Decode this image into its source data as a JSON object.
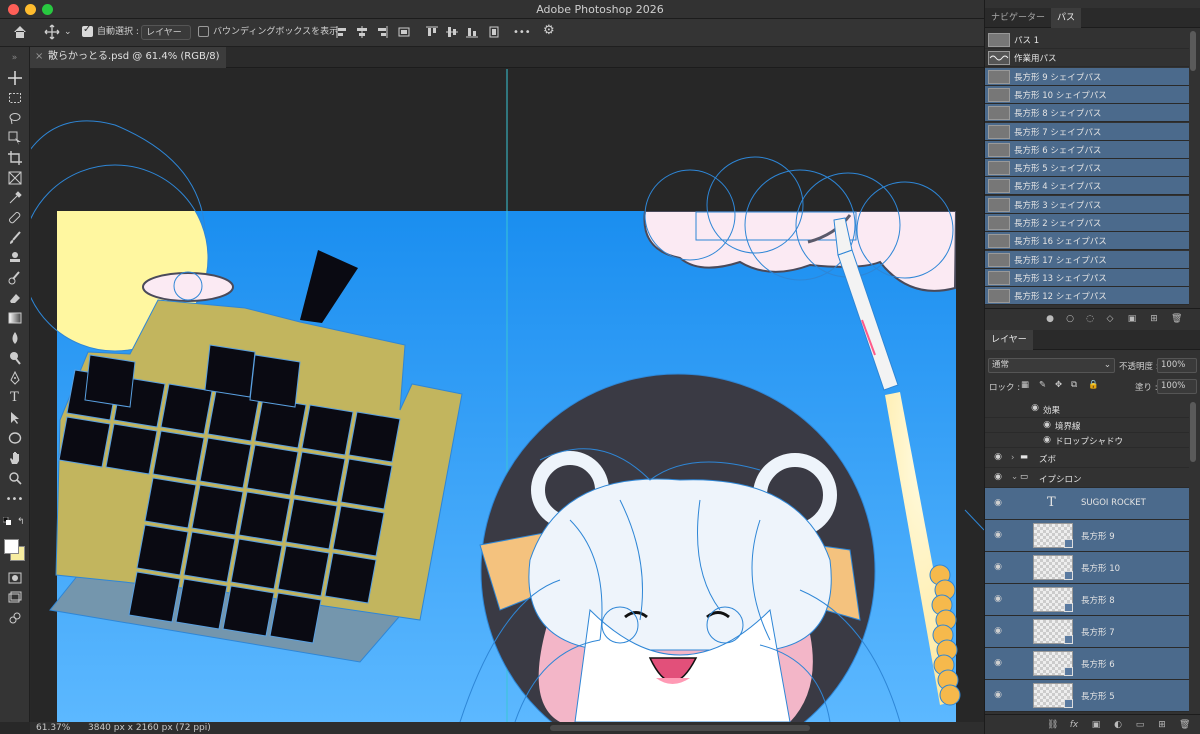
{
  "window": {
    "title": "Adobe Photoshop 2026"
  },
  "options_bar": {
    "auto_select_label": "自動選択 :",
    "auto_select_target": "レイヤー",
    "show_bbox_label": "バウンディングボックスを表示",
    "more": "•••"
  },
  "document": {
    "tab_title": "散らかっとる.psd @ 61.4% (RGB/8) *"
  },
  "status": {
    "zoom": "61.37%",
    "dimensions": "3840 px x 2160 px (72 ppi)"
  },
  "panel_tabs": {
    "navigator": "ナビゲーター",
    "paths": "パス"
  },
  "paths": [
    {
      "name": "パス 1",
      "selected": false,
      "thumb": "plain"
    },
    {
      "name": "作業用パス",
      "selected": false,
      "thumb": "wave"
    },
    {
      "name": "長方形 9 シェイプパス",
      "selected": true,
      "thumb": "plain"
    },
    {
      "name": "長方形 10 シェイプパス",
      "selected": true,
      "thumb": "plain"
    },
    {
      "name": "長方形 8 シェイプパス",
      "selected": true,
      "thumb": "plain"
    },
    {
      "name": "長方形 7 シェイプパス",
      "selected": true,
      "thumb": "plain"
    },
    {
      "name": "長方形 6 シェイプパス",
      "selected": true,
      "thumb": "plain"
    },
    {
      "name": "長方形 5 シェイプパス",
      "selected": true,
      "thumb": "plain"
    },
    {
      "name": "長方形 4 シェイプパス",
      "selected": true,
      "thumb": "plain"
    },
    {
      "name": "長方形 3 シェイプパス",
      "selected": true,
      "thumb": "plain"
    },
    {
      "name": "長方形 2 シェイプパス",
      "selected": true,
      "thumb": "plain"
    },
    {
      "name": "長方形 16 シェイプパス",
      "selected": true,
      "thumb": "plain"
    },
    {
      "name": "長方形 17 シェイプパス",
      "selected": true,
      "thumb": "plain"
    },
    {
      "name": "長方形 13 シェイプパス",
      "selected": true,
      "thumb": "plain"
    },
    {
      "name": "長方形 12 シェイプパス",
      "selected": true,
      "thumb": "plain"
    }
  ],
  "layers_panel": {
    "tab": "レイヤー",
    "blend_mode": "通常",
    "opacity_label": "不透明度 :",
    "opacity_value": "100%",
    "lock_label": "ロック :",
    "fill_label": "塗り :",
    "fill_value": "100%",
    "effects_label": "効果",
    "effects": [
      "境界線",
      "ドロップシャドウ"
    ],
    "groups": [
      "ズボ",
      "イプシロン"
    ],
    "text_layer": "SUGOI ROCKET",
    "text_icon": "T",
    "shape_layers": [
      "長方形 9",
      "長方形 10",
      "長方形 8",
      "長方形 7",
      "長方形 6",
      "長方形 5"
    ]
  },
  "colors": {
    "sky_top": "#1a8ef0",
    "sky_bottom": "#5cb8ff",
    "building": "#c2b55e",
    "window": "#0a0a12",
    "moon": "#fff7a0",
    "cloud": "#fbeaf3",
    "path_line": "#2e86d6",
    "selection": "#4b6a8c"
  }
}
